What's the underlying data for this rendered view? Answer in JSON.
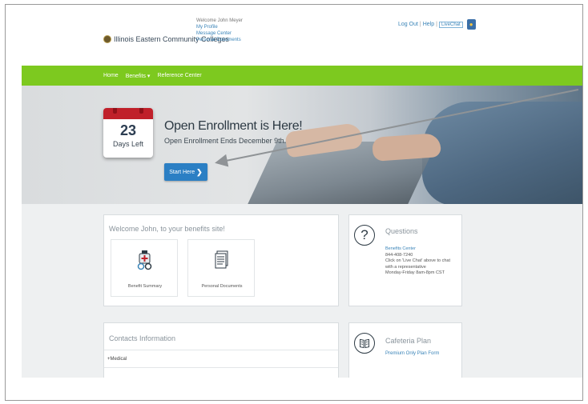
{
  "header": {
    "logo_text": "Illinois Eastern Community Colleges",
    "welcome": "Welcome John Meyer",
    "links": [
      "My Profile",
      "Message Center",
      "Personal Documents"
    ],
    "logout": "Log Out",
    "help": "Help",
    "live_chat": "LiveChat"
  },
  "nav": {
    "items": [
      "Home",
      "Benefits",
      "Reference Center"
    ]
  },
  "hero": {
    "day_number": "23",
    "days_left": "Days Left",
    "title": "Open Enrollment is Here!",
    "subtitle": "Open Enrollment Ends December 9th.",
    "button_label": "Start Here"
  },
  "welcome_card": {
    "title": "Welcome John, to your benefits site!",
    "tiles": [
      "Benefit Summary",
      "Personal Documents"
    ]
  },
  "questions": {
    "title": "Questions",
    "center": "Benefits Center",
    "phone": "844-408-7240",
    "line1": "Click on 'Live Chat' above to chat",
    "line2": "with a representative",
    "hours": "Monday-Friday 8am-8pm CST"
  },
  "contacts": {
    "title": "Contacts Information",
    "row": "Medical"
  },
  "cafeteria": {
    "title": "Cafeteria Plan",
    "link": "Premium Only Plan Form"
  },
  "colors": {
    "nav_green": "#7dc91f",
    "button_blue": "#2b7fc4",
    "calendar_red": "#c0202a",
    "link_blue": "#3a84b8"
  }
}
